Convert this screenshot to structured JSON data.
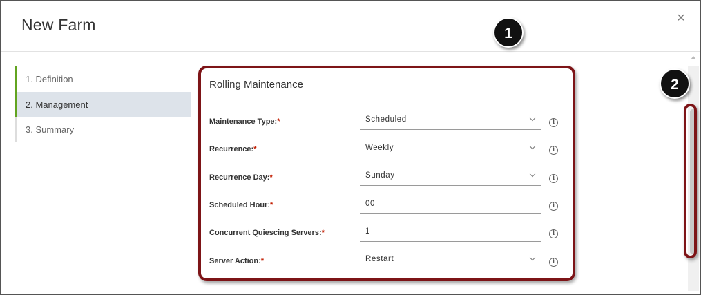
{
  "dialog": {
    "title": "New Farm",
    "close_glyph": "×"
  },
  "steps": [
    {
      "label": "1. Definition",
      "state": "done"
    },
    {
      "label": "2. Management",
      "state": "active"
    },
    {
      "label": "3. Summary",
      "state": "pending"
    }
  ],
  "section": {
    "title": "Rolling Maintenance"
  },
  "fields": [
    {
      "label": "Maintenance Type:",
      "value": "Scheduled",
      "type": "select"
    },
    {
      "label": "Recurrence:",
      "value": "Weekly",
      "type": "select"
    },
    {
      "label": "Recurrence Day:",
      "value": "Sunday",
      "type": "select"
    },
    {
      "label": "Scheduled Hour:",
      "value": "00",
      "type": "text"
    },
    {
      "label": "Concurrent Quiescing Servers:",
      "value": "1",
      "type": "text"
    },
    {
      "label": "Server Action:",
      "value": "Restart",
      "type": "select"
    }
  ],
  "required_marker": "*",
  "info_glyph": "i",
  "callouts": [
    {
      "number": "1"
    },
    {
      "number": "2"
    }
  ],
  "colors": {
    "accent_green": "#62a420",
    "callout_border": "#7d1417",
    "required": "#c21d00"
  }
}
